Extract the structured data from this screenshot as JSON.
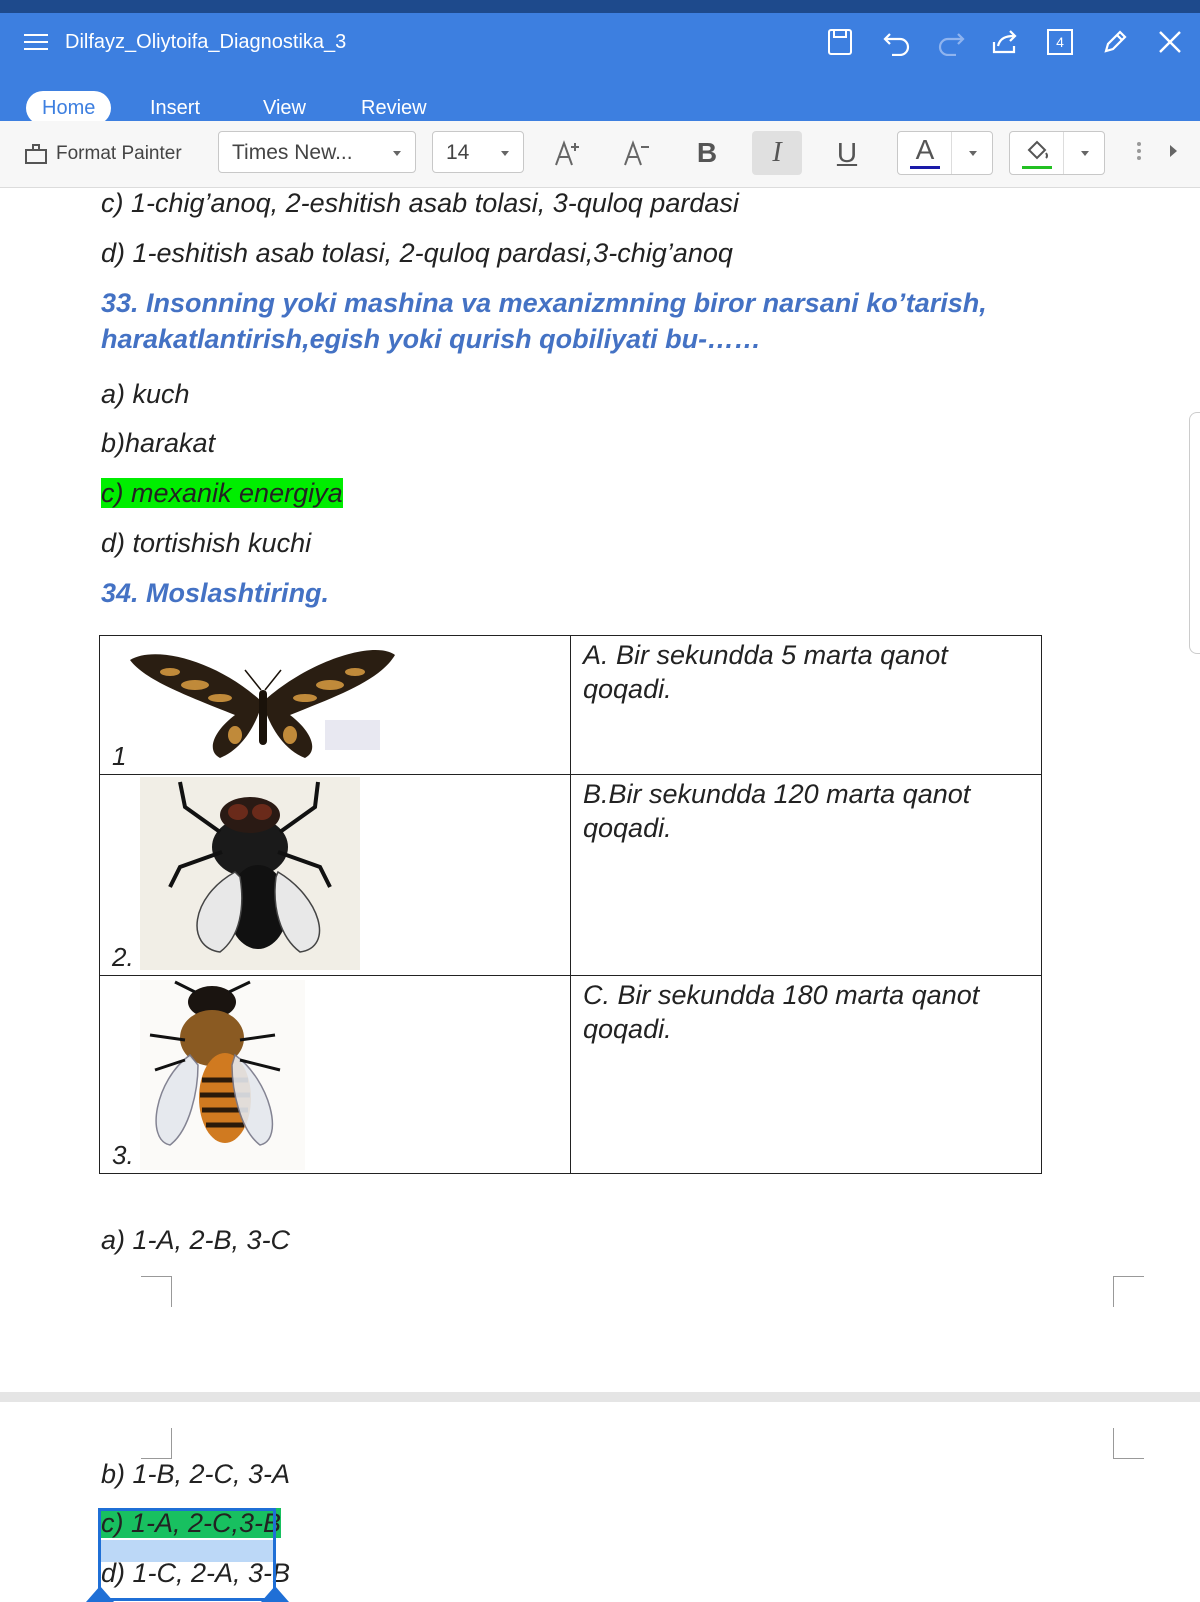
{
  "app": {
    "title": "Dilfayz_Oliytoifa_Diagnostika_3",
    "tab_count": "4",
    "tabs": [
      "Home",
      "Insert",
      "View",
      "Review"
    ],
    "accent_color": "#3d7fe0"
  },
  "toolbar": {
    "format_painter": "Format Painter",
    "font_name": "Times New...",
    "font_size": "14",
    "bold": "B",
    "italic": "I",
    "underline": "U",
    "font_color_glyph": "A"
  },
  "doc": {
    "lines": [
      "c) 1-chig’anoq, 2-eshitish asab tolasi, 3-quloq pardasi",
      "d) 1-eshitish asab tolasi, 2-quloq pardasi,3-chig’anoq"
    ],
    "q33_line1": "33. Insonning yoki mashina va mexanizmning biror narsani ko’tarish,",
    "q33_line2": "harakatlantirish,egish yoki qurish qobiliyati bu-……",
    "q33_options": [
      "a) kuch",
      "b)harakat",
      "c) mexanik energiya",
      "d) tortishish kuchi"
    ],
    "q34_title": "34. Moslashtiring.",
    "table": [
      {
        "num": "1",
        "image": "butterfly",
        "text": "A. Bir sekundda 5 marta qanot qoqadi."
      },
      {
        "num": "2.",
        "image": "fly",
        "text": "B.Bir sekundda 120 marta qanot qoqadi."
      },
      {
        "num": "3.",
        "image": "bee",
        "text": "C. Bir sekundda 180 marta qanot qoqadi."
      }
    ],
    "q34_options": [
      "a) 1-A, 2-B, 3-C",
      "b) 1-B, 2-C, 3-A",
      "c) 1-A, 2-C,3-B",
      "d) 1-C, 2-A, 3-B"
    ],
    "highlight_color": "#00ee00"
  }
}
